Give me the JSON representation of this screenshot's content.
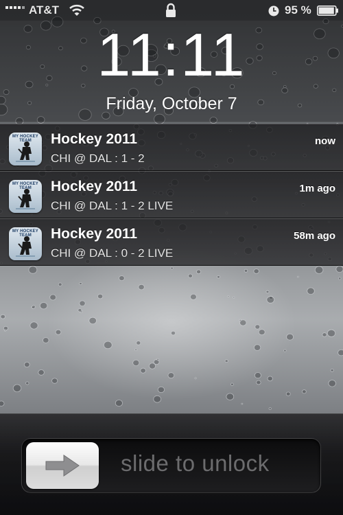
{
  "status_bar": {
    "carrier": "AT&T",
    "battery_percent": "95 %",
    "battery_level": 0.95,
    "icons": [
      "signal-icon",
      "wifi-icon",
      "lock-icon",
      "alarm-clock-icon",
      "battery-icon"
    ]
  },
  "lock_screen": {
    "time": "11:11",
    "date": "Friday, October 7"
  },
  "notifications": [
    {
      "app": "Hockey 2011",
      "icon_text": "MY HOCKEY TEAM",
      "message": "CHI @ DAL : 1 - 2",
      "time": "now"
    },
    {
      "app": "Hockey 2011",
      "icon_text": "MY HOCKEY TEAM",
      "message": "CHI @ DAL : 1 - 2 LIVE",
      "time": "1m ago"
    },
    {
      "app": "Hockey 2011",
      "icon_text": "MY HOCKEY TEAM",
      "message": "CHI @ DAL : 0 - 2 LIVE",
      "time": "58m ago"
    }
  ],
  "unlock": {
    "label": "slide to unlock",
    "knob_icon": "arrow-right-icon"
  },
  "colors": {
    "text": "#ffffff",
    "unlock_label": "#6c6c6e",
    "icon_navy": "#1b3b63"
  }
}
